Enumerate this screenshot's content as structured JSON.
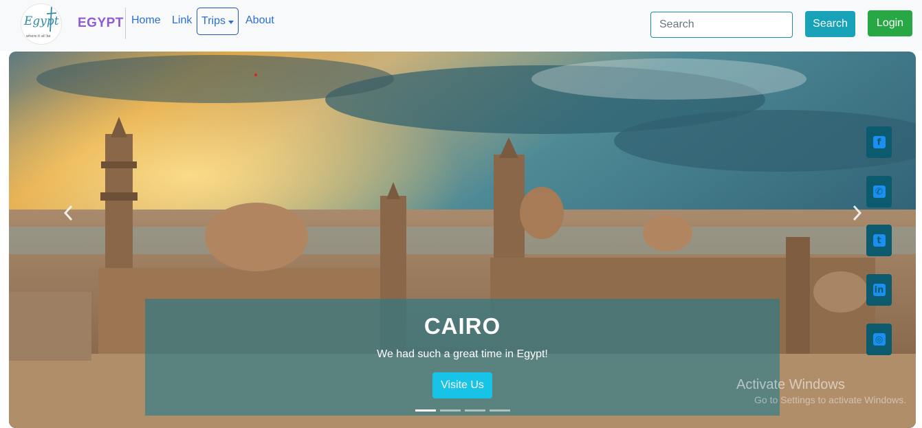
{
  "navbar": {
    "logo_text": "Egypt",
    "logo_tagline": "where it all be",
    "brand": "EGYPT",
    "links": {
      "home": "Home",
      "link": "Link",
      "trips": "Trips",
      "about": "About"
    },
    "search": {
      "placeholder": "Search",
      "button": "Search"
    },
    "login": "Login"
  },
  "carousel": {
    "caption": {
      "title": "CAIRO",
      "text": "We had such a great time in Egypt!",
      "button": "Visite Us"
    },
    "indicator_count": 4,
    "active_index": 0
  },
  "social": [
    {
      "icon": "facebook-icon",
      "glyph": "f"
    },
    {
      "icon": "whatsapp-icon",
      "glyph": "✆"
    },
    {
      "icon": "twitter-icon",
      "glyph": "t"
    },
    {
      "icon": "linkedin-icon",
      "glyph": "in"
    },
    {
      "icon": "instagram-icon",
      "glyph": "◎"
    }
  ],
  "watermark": {
    "title": "Activate Windows",
    "subtitle": "Go to Settings to activate Windows."
  },
  "colors": {
    "brand": "#8e5bd8",
    "link": "#2a6fd1",
    "info": "#17a2b8",
    "success": "#28a745",
    "caption_button": "#17c4e8"
  }
}
